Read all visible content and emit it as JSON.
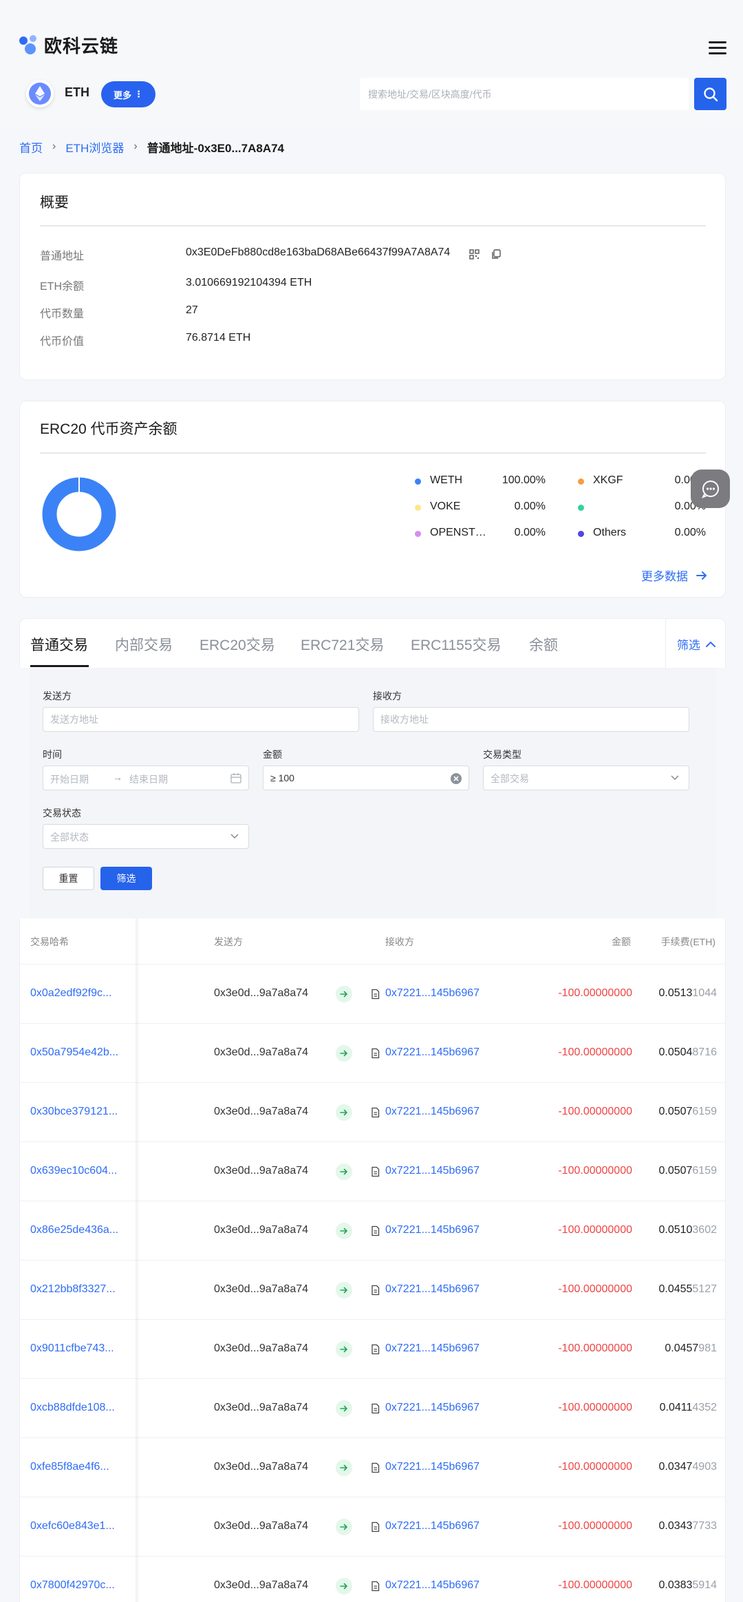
{
  "brand": {
    "name": "欧科云链",
    "accent": "#2563eb"
  },
  "chain": {
    "name": "ETH",
    "more_label": "更多",
    "search_placeholder": "搜索地址/交易/区块高度/代币"
  },
  "breadcrumb": {
    "home": "首页",
    "explorer": "ETH浏览器",
    "current": "普通地址-0x3E0...7A8A74"
  },
  "overview": {
    "title": "概要",
    "rows": [
      {
        "label": "普通地址",
        "value": "0x3E0DeFb880cd8e163baD68ABe66437f99A7A8A74"
      },
      {
        "label": "ETH余额",
        "value": "3.010669192104394 ETH"
      },
      {
        "label": "代币数量",
        "value": "27"
      },
      {
        "label": "代币价值",
        "value": "76.8714 ETH"
      }
    ]
  },
  "erc20": {
    "title": "ERC20 代币资产余额",
    "legend": [
      {
        "name": "WETH",
        "pct": "100.00%",
        "color": "#3b82f6"
      },
      {
        "name": "XKGF",
        "pct": "0.00%",
        "color": "#f59e42"
      },
      {
        "name": "VOKE",
        "pct": "0.00%",
        "color": "#fde68a"
      },
      {
        "name": "",
        "pct": "0.00%",
        "color": "#34d399"
      },
      {
        "name": "OPENST…",
        "pct": "0.00%",
        "color": "#d88cf5"
      },
      {
        "name": "Others",
        "pct": "0.00%",
        "color": "#4f46e5"
      }
    ],
    "more_label": "更多数据"
  },
  "tabs": {
    "items": [
      "普通交易",
      "内部交易",
      "ERC20交易",
      "ERC721交易",
      "ERC1155交易",
      "余额"
    ],
    "filter_label": "筛选"
  },
  "filter": {
    "from_label": "发送方",
    "from_placeholder": "发送方地址",
    "to_label": "接收方",
    "to_placeholder": "接收方地址",
    "time_label": "时间",
    "start_placeholder": "开始日期",
    "end_placeholder": "结束日期",
    "amount_label": "金额",
    "amount_value": "≥ 100",
    "type_label": "交易类型",
    "type_value": "全部交易",
    "status_label": "交易状态",
    "status_value": "全部状态",
    "reset_label": "重置",
    "submit_label": "筛选"
  },
  "table": {
    "headers": {
      "hash": "交易哈希",
      "from": "发送方",
      "to": "接收方",
      "amount": "金额",
      "fee": "手续费(ETH)"
    },
    "rows": [
      {
        "hash": "0x0a2edf92f9c...",
        "from": "0x3e0d...9a7a8a74",
        "to": "0x7221...145b6967",
        "amount": "-100.00000000",
        "fee_main": "0.0513",
        "fee_tail": "1044"
      },
      {
        "hash": "0x50a7954e42b...",
        "from": "0x3e0d...9a7a8a74",
        "to": "0x7221...145b6967",
        "amount": "-100.00000000",
        "fee_main": "0.0504",
        "fee_tail": "8716"
      },
      {
        "hash": "0x30bce379121...",
        "from": "0x3e0d...9a7a8a74",
        "to": "0x7221...145b6967",
        "amount": "-100.00000000",
        "fee_main": "0.0507",
        "fee_tail": "6159"
      },
      {
        "hash": "0x639ec10c604...",
        "from": "0x3e0d...9a7a8a74",
        "to": "0x7221...145b6967",
        "amount": "-100.00000000",
        "fee_main": "0.0507",
        "fee_tail": "6159"
      },
      {
        "hash": "0x86e25de436a...",
        "from": "0x3e0d...9a7a8a74",
        "to": "0x7221...145b6967",
        "amount": "-100.00000000",
        "fee_main": "0.0510",
        "fee_tail": "3602"
      },
      {
        "hash": "0x212bb8f3327...",
        "from": "0x3e0d...9a7a8a74",
        "to": "0x7221...145b6967",
        "amount": "-100.00000000",
        "fee_main": "0.0455",
        "fee_tail": "5127"
      },
      {
        "hash": "0x9011cfbe743...",
        "from": "0x3e0d...9a7a8a74",
        "to": "0x7221...145b6967",
        "amount": "-100.00000000",
        "fee_main": "0.0457",
        "fee_tail": "981"
      },
      {
        "hash": "0xcb88dfde108...",
        "from": "0x3e0d...9a7a8a74",
        "to": "0x7221...145b6967",
        "amount": "-100.00000000",
        "fee_main": "0.0411",
        "fee_tail": "4352"
      },
      {
        "hash": "0xfe85f8ae4f6...",
        "from": "0x3e0d...9a7a8a74",
        "to": "0x7221...145b6967",
        "amount": "-100.00000000",
        "fee_main": "0.0347",
        "fee_tail": "4903"
      },
      {
        "hash": "0xefc60e843e1...",
        "from": "0x3e0d...9a7a8a74",
        "to": "0x7221...145b6967",
        "amount": "-100.00000000",
        "fee_main": "0.0343",
        "fee_tail": "7733"
      },
      {
        "hash": "0x7800f42970c...",
        "from": "0x3e0d...9a7a8a74",
        "to": "0x7221...145b6967",
        "amount": "-100.00000000",
        "fee_main": "0.0383",
        "fee_tail": "5914"
      }
    ]
  }
}
